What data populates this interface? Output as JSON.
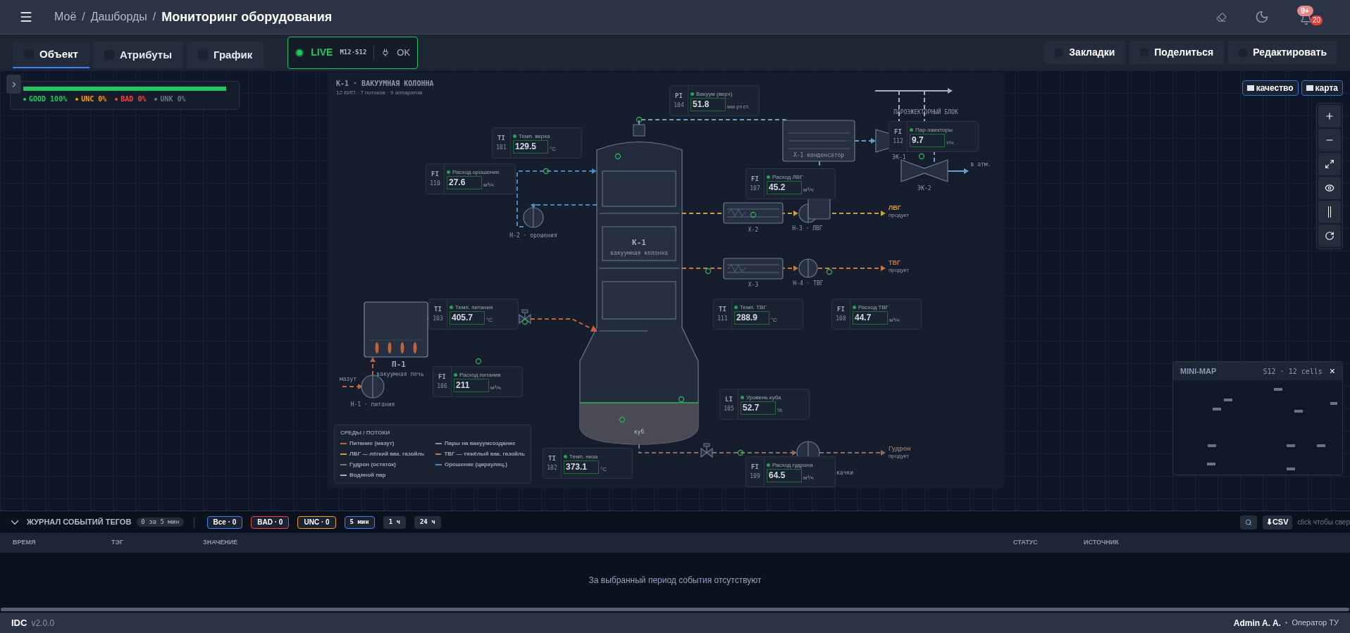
{
  "header": {
    "separator": "/",
    "breadcrumbs": [
      {
        "label": "Моё",
        "current": false
      },
      {
        "label": "Дашборды",
        "current": false
      },
      {
        "label": "Мониторинг оборудования",
        "current": true
      }
    ],
    "notifications": {
      "badge": "9+",
      "count": "20"
    }
  },
  "tabs": [
    {
      "label": "Объект",
      "selected": true
    },
    {
      "label": "Атрибуты",
      "selected": false
    },
    {
      "label": "График",
      "selected": false
    }
  ],
  "live": {
    "status": "LIVE",
    "cell": "M12·S12",
    "link": "OK"
  },
  "actions": [
    "Закладки",
    "Поделиться",
    "Редактировать"
  ],
  "quality": {
    "level": 1,
    "items": [
      {
        "label": "GOOD 100%",
        "color": "#22c55e"
      },
      {
        "label": "UNC 0%",
        "color": "#f59e0b"
      },
      {
        "label": "BAD 0%",
        "color": "#ef4444"
      },
      {
        "label": "UNK 0%",
        "color": "#6b7280"
      }
    ]
  },
  "view_toggles": [
    "качество",
    "карта"
  ],
  "diagram": {
    "title": "К-1 · ВАКУУМНАЯ КОЛОННА",
    "subtitle": "12 КИП · 7 потоков · 9 аппаратов",
    "instruments": [
      {
        "tag": "PI",
        "number": "104",
        "label": "Вакуум (верх)",
        "value": "51.8",
        "unit": "мм рт.ст."
      },
      {
        "tag": "FI",
        "number": "112",
        "label": "Пар-эжекторы",
        "value": "9.7",
        "unit": "т/ч"
      },
      {
        "tag": "TI",
        "number": "101",
        "label": "Темп. верха",
        "value": "129.5",
        "unit": "°C"
      },
      {
        "tag": "FI",
        "number": "110",
        "label": "Расход орошения",
        "value": "27.6",
        "unit": "м³/ч"
      },
      {
        "tag": "FI",
        "number": "107",
        "label": "Расход ЛВГ",
        "value": "45.2",
        "unit": "м³/ч"
      },
      {
        "tag": "TI",
        "number": "103",
        "label": "Темп. питания",
        "value": "405.7",
        "unit": "°C"
      },
      {
        "tag": "TI",
        "number": "111",
        "label": "Темп. ТВГ",
        "value": "288.9",
        "unit": "°C"
      },
      {
        "tag": "FI",
        "number": "108",
        "label": "Расход ТВГ",
        "value": "44.7",
        "unit": "м³/ч"
      },
      {
        "tag": "FI",
        "number": "106",
        "label": "Расход питания",
        "value": "211",
        "unit": "м³/ч"
      },
      {
        "tag": "LI",
        "number": "105",
        "label": "Уровень куба",
        "value": "52.7",
        "unit": "%"
      },
      {
        "tag": "TI",
        "number": "102",
        "label": "Темп. низа",
        "value": "373.1",
        "unit": "°C"
      },
      {
        "tag": "FI",
        "number": "109",
        "label": "Расход гудрона",
        "value": "64.5",
        "unit": "м³/ч"
      }
    ],
    "equipment_labels": [
      "К-1",
      "вакуумная колонна",
      "куб",
      "Н-2 · орошения",
      "П-1",
      "вакуумная печь",
      "мазут",
      "Н-1 · питания",
      "Х-1 конденсатор",
      "ПАРОЭЖЕКТОРНЫЙ БЛОК",
      "ЭК-1",
      "ЭК-2",
      "в атм.",
      "Х-2",
      "Н-3 · ЛВГ",
      "Х-3",
      "Н-4 · ТВГ",
      "качки"
    ],
    "products": [
      {
        "name": "ЛВГ",
        "note": "продукт"
      },
      {
        "name": "ТВГ",
        "note": "продукт"
      },
      {
        "name": "Гудрон",
        "note": "продукт"
      }
    ],
    "legend": {
      "title": "СРЕДЫ / ПОТОКИ",
      "items": [
        {
          "label": "Питание (мазут)",
          "color": "#c0643c"
        },
        {
          "label": "Пары на вакуумсоздание",
          "color": "#6f9cc6"
        },
        {
          "label": "ЛВГ — лёгкий вак. газойль",
          "color": "#c9a040"
        },
        {
          "label": "ТВГ — тяжёлый вак. газойль",
          "color": "#c87a3c"
        },
        {
          "label": "Гудрон (остаток)",
          "color": "#8a7062"
        },
        {
          "label": "Орошение (циркуляц.)",
          "color": "#4a86c0"
        },
        {
          "label": "Водяной пар",
          "color": "#a8b0c0"
        }
      ]
    }
  },
  "minimap": {
    "title": "MINI-MAP",
    "info": "S12 · 12 cells",
    "close": "×"
  },
  "event_log": {
    "title": "ЖУРНАЛ СОБЫТИЙ ТЕГОВ",
    "count": "0 за 5 мин",
    "status_filters": [
      {
        "label": "Все · 0",
        "color": "#3b82f6"
      },
      {
        "label": "BAD · 0",
        "color": "#ef4444"
      },
      {
        "label": "UNC · 0",
        "color": "#f59e0b"
      }
    ],
    "periods": [
      {
        "label": "5 мин",
        "selected": true
      },
      {
        "label": "1 ч",
        "selected": false
      },
      {
        "label": "24 ч",
        "selected": false
      }
    ],
    "export": "⬇CSV",
    "hint": "click чтобы свер",
    "columns": [
      "ВРЕМЯ",
      "ТЭГ",
      "ЗНАЧЕНИЕ",
      "СТАТУС",
      "ИСТОЧНИК"
    ],
    "empty": "За выбранный период события отсутствуют"
  },
  "footer": {
    "app": "IDC",
    "version": "v2.0.0",
    "user": "Admin A. A.",
    "role": "Оператор ТУ",
    "separator": "•"
  }
}
